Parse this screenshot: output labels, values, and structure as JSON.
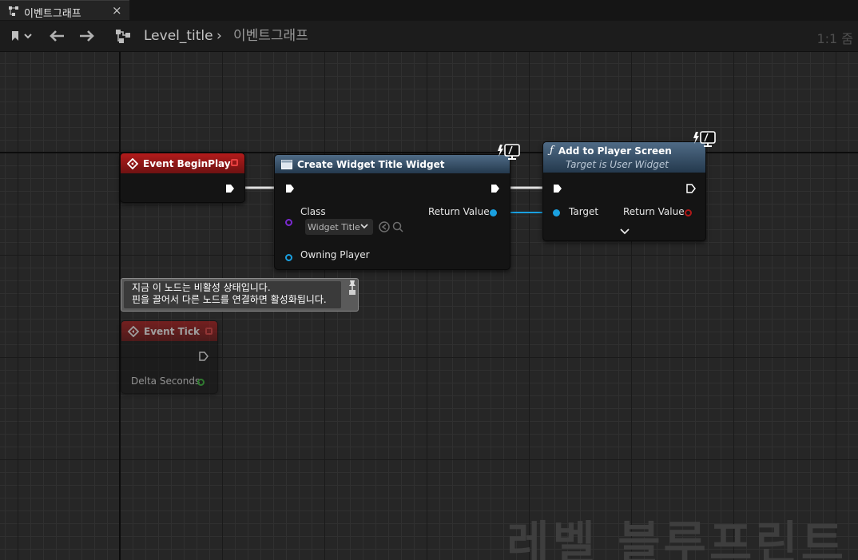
{
  "tab": {
    "label": "이벤트그래프",
    "close": "×"
  },
  "breadcrumb": {
    "root": "Level_title",
    "separator": "›",
    "current": "이벤트그래프"
  },
  "zoom": "1:1 줌",
  "nodes": {
    "begin_play": {
      "title": "Event BeginPlay"
    },
    "create_widget": {
      "title": "Create Widget Title Widget",
      "class_label": "Class",
      "class_value": "Widget Title",
      "owning_player_label": "Owning Player",
      "return_value_label": "Return Value"
    },
    "add_to_player_screen": {
      "title": "Add to Player Screen",
      "subtitle": "Target is User Widget",
      "target_label": "Target",
      "return_value_label": "Return Value"
    },
    "event_tick": {
      "title": "Event Tick",
      "delta_seconds_label": "Delta Seconds"
    }
  },
  "tooltip": {
    "line1": "지금 이 노드는 비활성 상태입니다.",
    "line2": "핀을 끌어서 다른 노드를 연결하면 활성화됩니다."
  },
  "watermark": "레벨 블루프린트",
  "colors": {
    "event_header": "#b31b1b",
    "function_header": "#4f6b86",
    "object_pin": "#1aa0e0",
    "class_pin": "#7a2ad0",
    "float_pin": "#38c038"
  }
}
